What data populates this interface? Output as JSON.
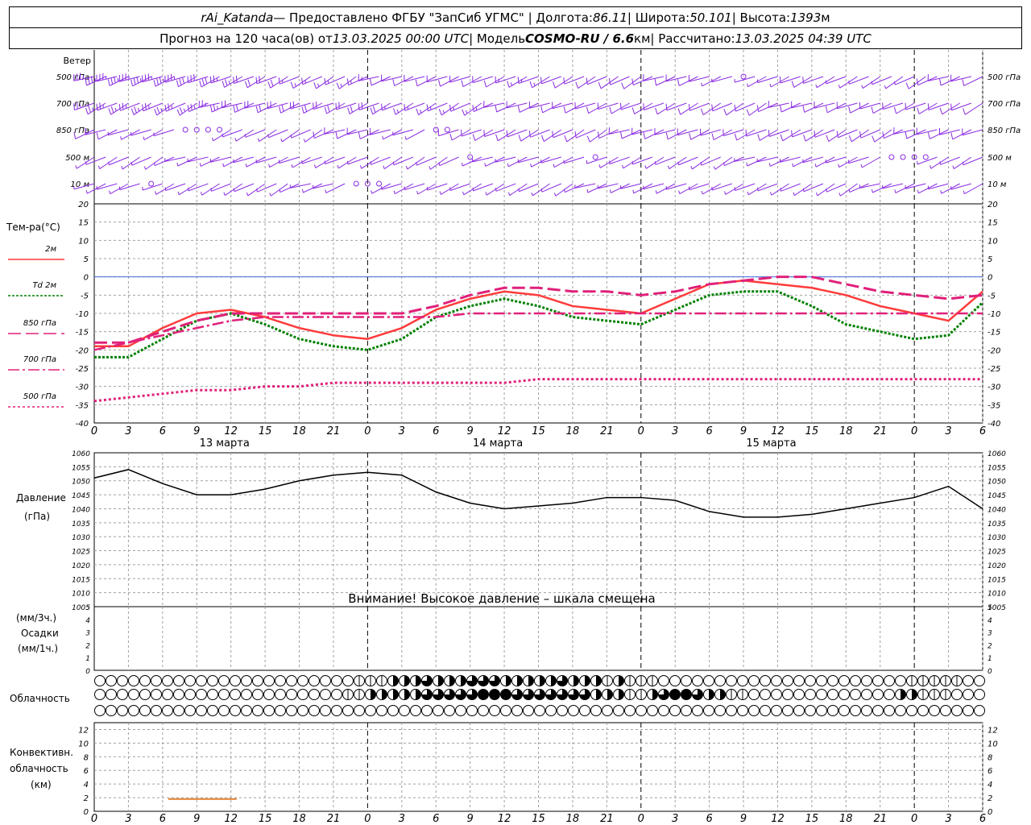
{
  "header": {
    "line1": {
      "station": "rAi_Katanda",
      "provider": " — Предоставлено ФГБУ \"ЗапСиб УГМС\" | Долгота: ",
      "lon": "86.11",
      "lat_label": " | Широта: ",
      "lat": "50.101",
      "alt_label": " | Высота: ",
      "alt": "1393",
      "alt_unit": "м"
    },
    "line2": {
      "forecast_label": "Прогноз на 120 часа(ов) от ",
      "forecast_from": "13.03.2025 00:00 UTC",
      "model_label": "  | Модель ",
      "model": "COSMO-RU / 6.6",
      "model_unit": "км",
      "calc_label": " | Рассчитано: ",
      "calc_time": "13.03.2025 04:39 UTC"
    }
  },
  "colors": {
    "wind": "#8a2be2",
    "t2m": "#ff3b3b",
    "td2m": "#008000",
    "t850": "#e0207a",
    "t700": "#e0207a",
    "t500": "#e0207a",
    "zero_line": "#4169e1",
    "pressure": "#000000",
    "convective": "#e08030",
    "grid": "#a0a0a0"
  },
  "time_axis": {
    "hours": [
      "0",
      "3",
      "6",
      "9",
      "12",
      "15",
      "18",
      "21",
      "0",
      "3",
      "6",
      "9",
      "12",
      "15",
      "18",
      "21",
      "0",
      "3",
      "6",
      "9",
      "12",
      "15",
      "18",
      "21",
      "0",
      "3",
      "6"
    ],
    "dates": [
      "13 марта",
      "14 марта",
      "15 марта"
    ]
  },
  "wind_panel": {
    "title": "Ветер",
    "levels": [
      "500 гПа",
      "700 гПа",
      "850 гПа",
      "500 м",
      "10 м"
    ]
  },
  "chart_data": [
    {
      "type": "line",
      "title": "Тем-ра(°C)",
      "ylim": [
        -40,
        20
      ],
      "yticks": [
        "20",
        "15",
        "10",
        "5",
        "0",
        "-5",
        "-10",
        "-15",
        "-20",
        "-25",
        "-30",
        "-35",
        "-40"
      ],
      "x": [
        0,
        3,
        6,
        9,
        12,
        15,
        18,
        21,
        24,
        27,
        30,
        33,
        36,
        39,
        42,
        45,
        48,
        51,
        54,
        57,
        60,
        63,
        66,
        69,
        72,
        75,
        78
      ],
      "series": [
        {
          "name": "2м",
          "values": [
            -19,
            -19,
            -14,
            -10,
            -9,
            -11,
            -14,
            -16,
            -17,
            -14,
            -9,
            -6,
            -4,
            -5,
            -8,
            -9,
            -10,
            -6,
            -2,
            -1,
            -2,
            -3,
            -5,
            -8,
            -10,
            -12,
            -4
          ]
        },
        {
          "name": "Td 2м",
          "values": [
            -22,
            -22,
            -17,
            -12,
            -10,
            -13,
            -17,
            -19,
            -20,
            -17,
            -11,
            -8,
            -6,
            -8,
            -11,
            -12,
            -13,
            -9,
            -5,
            -4,
            -4,
            -8,
            -13,
            -15,
            -17,
            -16,
            -7
          ]
        },
        {
          "name": "850 гПа",
          "values": [
            -18,
            -18,
            -15,
            -12,
            -10,
            -10,
            -10,
            -10,
            -10,
            -10,
            -8,
            -5,
            -3,
            -3,
            -4,
            -4,
            -5,
            -4,
            -2,
            -1,
            0,
            0,
            -2,
            -4,
            -5,
            -6,
            -5
          ]
        },
        {
          "name": "700 гПа",
          "values": [
            -20,
            -18,
            -16,
            -14,
            -12,
            -11,
            -11,
            -11,
            -11,
            -11,
            -11,
            -10,
            -10,
            -10,
            -10,
            -10,
            -10,
            -10,
            -10,
            -10,
            -10,
            -10,
            -10,
            -10,
            -10,
            -10,
            -10
          ]
        },
        {
          "name": "500 гПа",
          "values": [
            -34,
            -33,
            -32,
            -31,
            -31,
            -30,
            -30,
            -29,
            -29,
            -29,
            -29,
            -29,
            -29,
            -28,
            -28,
            -28,
            -28,
            -28,
            -28,
            -28,
            -28,
            -28,
            -28,
            -28,
            -28,
            -28,
            -28
          ]
        }
      ]
    },
    {
      "type": "line",
      "title": "Давление",
      "ylabel": "(гПа)",
      "ylim": [
        1005,
        1060
      ],
      "yticks": [
        "1060",
        "1055",
        "1050",
        "1045",
        "1040",
        "1035",
        "1030",
        "1025",
        "1020",
        "1015",
        "1010",
        "1005"
      ],
      "note": "Внимание! Высокое давление – шкала смещена",
      "x": [
        0,
        3,
        6,
        9,
        12,
        15,
        18,
        21,
        24,
        27,
        30,
        33,
        36,
        39,
        42,
        45,
        48,
        51,
        54,
        57,
        60,
        63,
        66,
        69,
        72,
        75,
        78
      ],
      "series": [
        {
          "values": [
            1051,
            1054,
            1049,
            1045,
            1045,
            1047,
            1050,
            1052,
            1053,
            1052,
            1046,
            1042,
            1040,
            1041,
            1042,
            1044,
            1044,
            1043,
            1039,
            1037,
            1037,
            1038,
            1040,
            1042,
            1044,
            1048,
            1040
          ]
        }
      ]
    },
    {
      "type": "bar",
      "title": "Осадки",
      "ylabel": "(мм/3ч.)",
      "ylabel2": "(мм/1ч.)",
      "ylim": [
        0,
        5
      ],
      "yticks": [
        "5",
        "4",
        "3",
        "2",
        "1",
        "0"
      ],
      "values": []
    },
    {
      "type": "line",
      "title": "Конвективн. облачность",
      "ylabel": "(км)",
      "ylim": [
        0,
        13
      ],
      "yticks": [
        "12",
        "10",
        "8",
        "6",
        "4",
        "2",
        "0"
      ],
      "series": [
        {
          "x": [
            6.5,
            12.5
          ],
          "values": [
            1.8,
            1.8
          ]
        }
      ]
    }
  ],
  "cloud_panel": {
    "title": "Облачность",
    "rows": [
      [
        0,
        0,
        0,
        0,
        0,
        0,
        0,
        0,
        0,
        0,
        0,
        0,
        0,
        0,
        0,
        0,
        0,
        0,
        0,
        0,
        0,
        0,
        0,
        1,
        1,
        1,
        2,
        2,
        2,
        3,
        2,
        2,
        2,
        3,
        3,
        3,
        2,
        2,
        2,
        2,
        2,
        3,
        2,
        2,
        2,
        1,
        2,
        1,
        1,
        1,
        0,
        0,
        0,
        0,
        0,
        0,
        0,
        0,
        0,
        0,
        0,
        0,
        0,
        0,
        0,
        0,
        0,
        0,
        0,
        0,
        0,
        0,
        1,
        1,
        1,
        1,
        1,
        0,
        0
      ],
      [
        0,
        0,
        0,
        0,
        0,
        0,
        0,
        0,
        0,
        0,
        0,
        0,
        0,
        0,
        0,
        0,
        0,
        0,
        0,
        0,
        0,
        0,
        1,
        1,
        2,
        2,
        2,
        2,
        2,
        3,
        3,
        3,
        3,
        3,
        4,
        4,
        4,
        3,
        3,
        3,
        3,
        3,
        3,
        3,
        2,
        2,
        2,
        1,
        1,
        2,
        3,
        4,
        4,
        3,
        2,
        2,
        1,
        1,
        0,
        0,
        0,
        0,
        0,
        0,
        0,
        0,
        0,
        0,
        0,
        0,
        0,
        2,
        2,
        1,
        1,
        1,
        0,
        0,
        0
      ],
      [
        0,
        0,
        0,
        0,
        0,
        0,
        0,
        0,
        0,
        0,
        0,
        0,
        0,
        0,
        0,
        0,
        0,
        0,
        0,
        0,
        0,
        0,
        0,
        0,
        0,
        0,
        0,
        0,
        0,
        0,
        0,
        0,
        0,
        0,
        0,
        0,
        0,
        0,
        0,
        0,
        0,
        0,
        0,
        0,
        0,
        0,
        0,
        0,
        0,
        0,
        0,
        0,
        0,
        0,
        0,
        0,
        0,
        0,
        0,
        0,
        0,
        0,
        0,
        0,
        0,
        0,
        0,
        0,
        0,
        0,
        0,
        0,
        0,
        0,
        0,
        0,
        0,
        0,
        0
      ]
    ]
  },
  "wind_rows": [
    [
      35,
      35,
      35,
      35,
      35,
      35,
      35,
      35,
      35,
      30,
      30,
      30,
      25,
      25,
      20,
      20,
      20,
      20,
      15,
      15,
      15,
      15,
      15,
      15,
      15,
      15,
      10,
      10,
      10,
      10,
      10,
      10,
      10,
      10,
      10,
      10,
      10,
      15,
      15,
      15,
      15,
      10,
      10,
      10,
      10,
      10,
      10,
      10,
      10,
      10,
      10,
      10,
      10,
      10,
      10,
      5,
      5,
      0,
      5,
      5,
      5,
      5,
      10,
      10,
      10,
      5,
      5,
      5,
      5,
      5,
      5,
      5,
      5,
      10,
      10,
      10,
      10,
      10,
      10
    ],
    [
      25,
      25,
      25,
      25,
      25,
      25,
      25,
      25,
      25,
      25,
      25,
      25,
      25,
      20,
      20,
      20,
      20,
      20,
      20,
      20,
      20,
      20,
      20,
      20,
      20,
      20,
      20,
      15,
      15,
      15,
      15,
      15,
      15,
      15,
      15,
      15,
      10,
      10,
      10,
      10,
      10,
      10,
      10,
      10,
      10,
      10,
      10,
      10,
      10,
      10,
      10,
      10,
      10,
      10,
      10,
      10,
      10,
      10,
      10,
      10,
      10,
      10,
      10,
      10,
      10,
      10,
      10,
      10,
      10,
      10,
      10,
      10,
      10,
      10,
      10,
      10,
      10,
      10,
      10
    ],
    [
      10,
      10,
      10,
      5,
      5,
      5,
      5,
      5,
      0,
      0,
      0,
      0,
      5,
      5,
      5,
      5,
      5,
      5,
      5,
      5,
      5,
      10,
      10,
      10,
      10,
      10,
      10,
      5,
      5,
      5,
      0,
      0,
      10,
      10,
      10,
      10,
      10,
      10,
      10,
      10,
      10,
      10,
      10,
      10,
      10,
      10,
      10,
      10,
      10,
      10,
      10,
      10,
      10,
      10,
      10,
      10,
      10,
      10,
      10,
      10,
      10,
      10,
      10,
      10,
      10,
      10,
      10,
      10,
      10,
      10,
      10,
      10,
      10,
      10,
      10,
      10,
      10,
      10,
      10
    ],
    [
      5,
      5,
      5,
      5,
      5,
      5,
      5,
      5,
      5,
      5,
      5,
      5,
      5,
      5,
      5,
      5,
      5,
      5,
      5,
      5,
      5,
      5,
      5,
      5,
      5,
      5,
      5,
      5,
      5,
      5,
      5,
      5,
      5,
      0,
      5,
      5,
      5,
      5,
      5,
      5,
      5,
      5,
      5,
      5,
      0,
      5,
      5,
      5,
      5,
      5,
      5,
      5,
      5,
      5,
      5,
      5,
      5,
      5,
      5,
      5,
      5,
      5,
      5,
      5,
      5,
      5,
      5,
      5,
      5,
      5,
      0,
      0,
      0,
      0,
      5,
      5,
      5,
      5,
      5
    ],
    [
      5,
      5,
      5,
      5,
      5,
      0,
      5,
      5,
      5,
      5,
      5,
      5,
      5,
      5,
      5,
      5,
      5,
      5,
      5,
      5,
      5,
      5,
      5,
      0,
      0,
      0,
      5,
      5,
      5,
      5,
      5,
      5,
      5,
      5,
      5,
      5,
      5,
      5,
      5,
      5,
      5,
      5,
      5,
      5,
      5,
      5,
      5,
      5,
      5,
      5,
      5,
      5,
      5,
      5,
      5,
      5,
      5,
      5,
      5,
      5,
      5,
      5,
      5,
      5,
      5,
      5,
      5,
      5,
      5,
      5,
      5,
      5,
      5,
      5,
      5,
      5,
      5,
      5,
      5
    ]
  ]
}
